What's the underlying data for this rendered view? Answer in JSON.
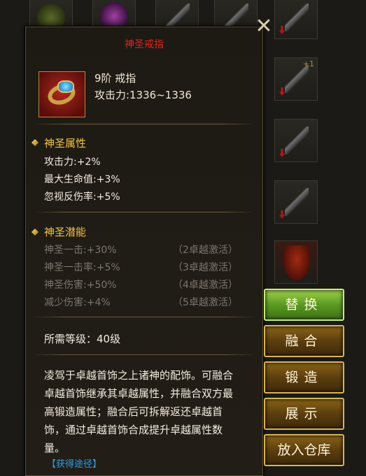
{
  "tooltip": {
    "title": "神圣戒指",
    "item": {
      "name": "9阶 戒指",
      "attack": "攻击力:1336~1336",
      "icon": "ring-icon"
    },
    "sacred_attributes": {
      "title": "神圣属性",
      "stats": [
        "攻击力:+2%",
        "最大生命值:+3%",
        "忽视反伤率:+5%"
      ]
    },
    "sacred_potential": {
      "title": "神圣潜能",
      "items": [
        {
          "name": "神圣一击:+30%",
          "requirement": "（2卓越激活）"
        },
        {
          "name": "神圣一击率:+5%",
          "requirement": "（3卓越激活）"
        },
        {
          "name": "神圣伤害:+50%",
          "requirement": "（4卓越激活）"
        },
        {
          "name": "减少伤害:+4%",
          "requirement": "（5卓越激活）"
        }
      ]
    },
    "required_level": "所需等级：40级",
    "description": "凌驾于卓越首饰之上诸神的配饰。可融合卓越首饰继承其卓越属性，并融合双方最高锻造属性；融合后可拆解返还卓越首饰，通过卓越首饰合成提升卓越属性数量。",
    "source_link": "【获得途径】"
  },
  "close_symbol": "✕",
  "actions": {
    "replace": "替换",
    "fuse": "融合",
    "forge": "锻造",
    "show": "展示",
    "store": "放入仓库"
  },
  "colors": {
    "title_red": "#e0251d",
    "section_gold": "#f2c24a",
    "inactive_gray": "#7c776c",
    "link_blue": "#2e9ee8",
    "button_green": "#5a9a22",
    "button_gold": "#8a6418"
  }
}
